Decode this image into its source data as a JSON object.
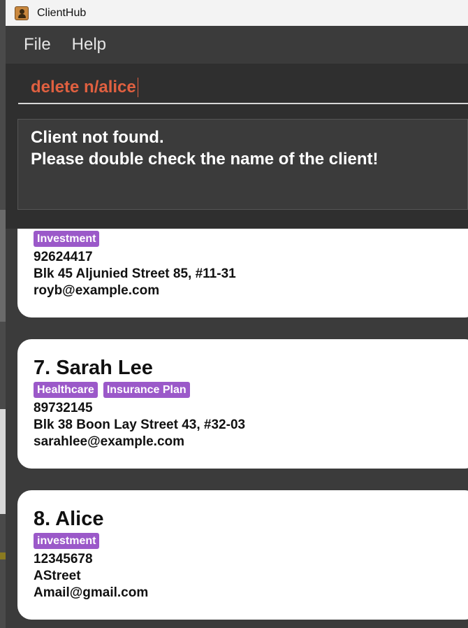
{
  "window": {
    "title": "ClientHub"
  },
  "menu": {
    "file": "File",
    "help": "Help"
  },
  "command": {
    "value": "delete n/alice"
  },
  "result": {
    "line1": "Client not found.",
    "line2": "Please double check the name of the client!"
  },
  "clients": [
    {
      "name": "",
      "tags": [
        "Investment"
      ],
      "phone": "92624417",
      "address": "Blk 45 Aljunied Street 85, #11-31",
      "email": "royb@example.com"
    },
    {
      "name": "7. Sarah Lee",
      "tags": [
        "Healthcare",
        "Insurance Plan"
      ],
      "phone": "89732145",
      "address": "Blk 38 Boon Lay Street 43, #32-03",
      "email": "sarahlee@example.com"
    },
    {
      "name": "8. Alice",
      "tags": [
        "investment"
      ],
      "phone": "12345678",
      "address": "AStreet",
      "email": "Amail@gmail.com"
    }
  ],
  "colors": {
    "command_text": "#e06040",
    "tag_bg": "#9b59c9",
    "panel_bg": "#3b3b3b"
  },
  "icons": {
    "app": "contact-book-icon"
  }
}
